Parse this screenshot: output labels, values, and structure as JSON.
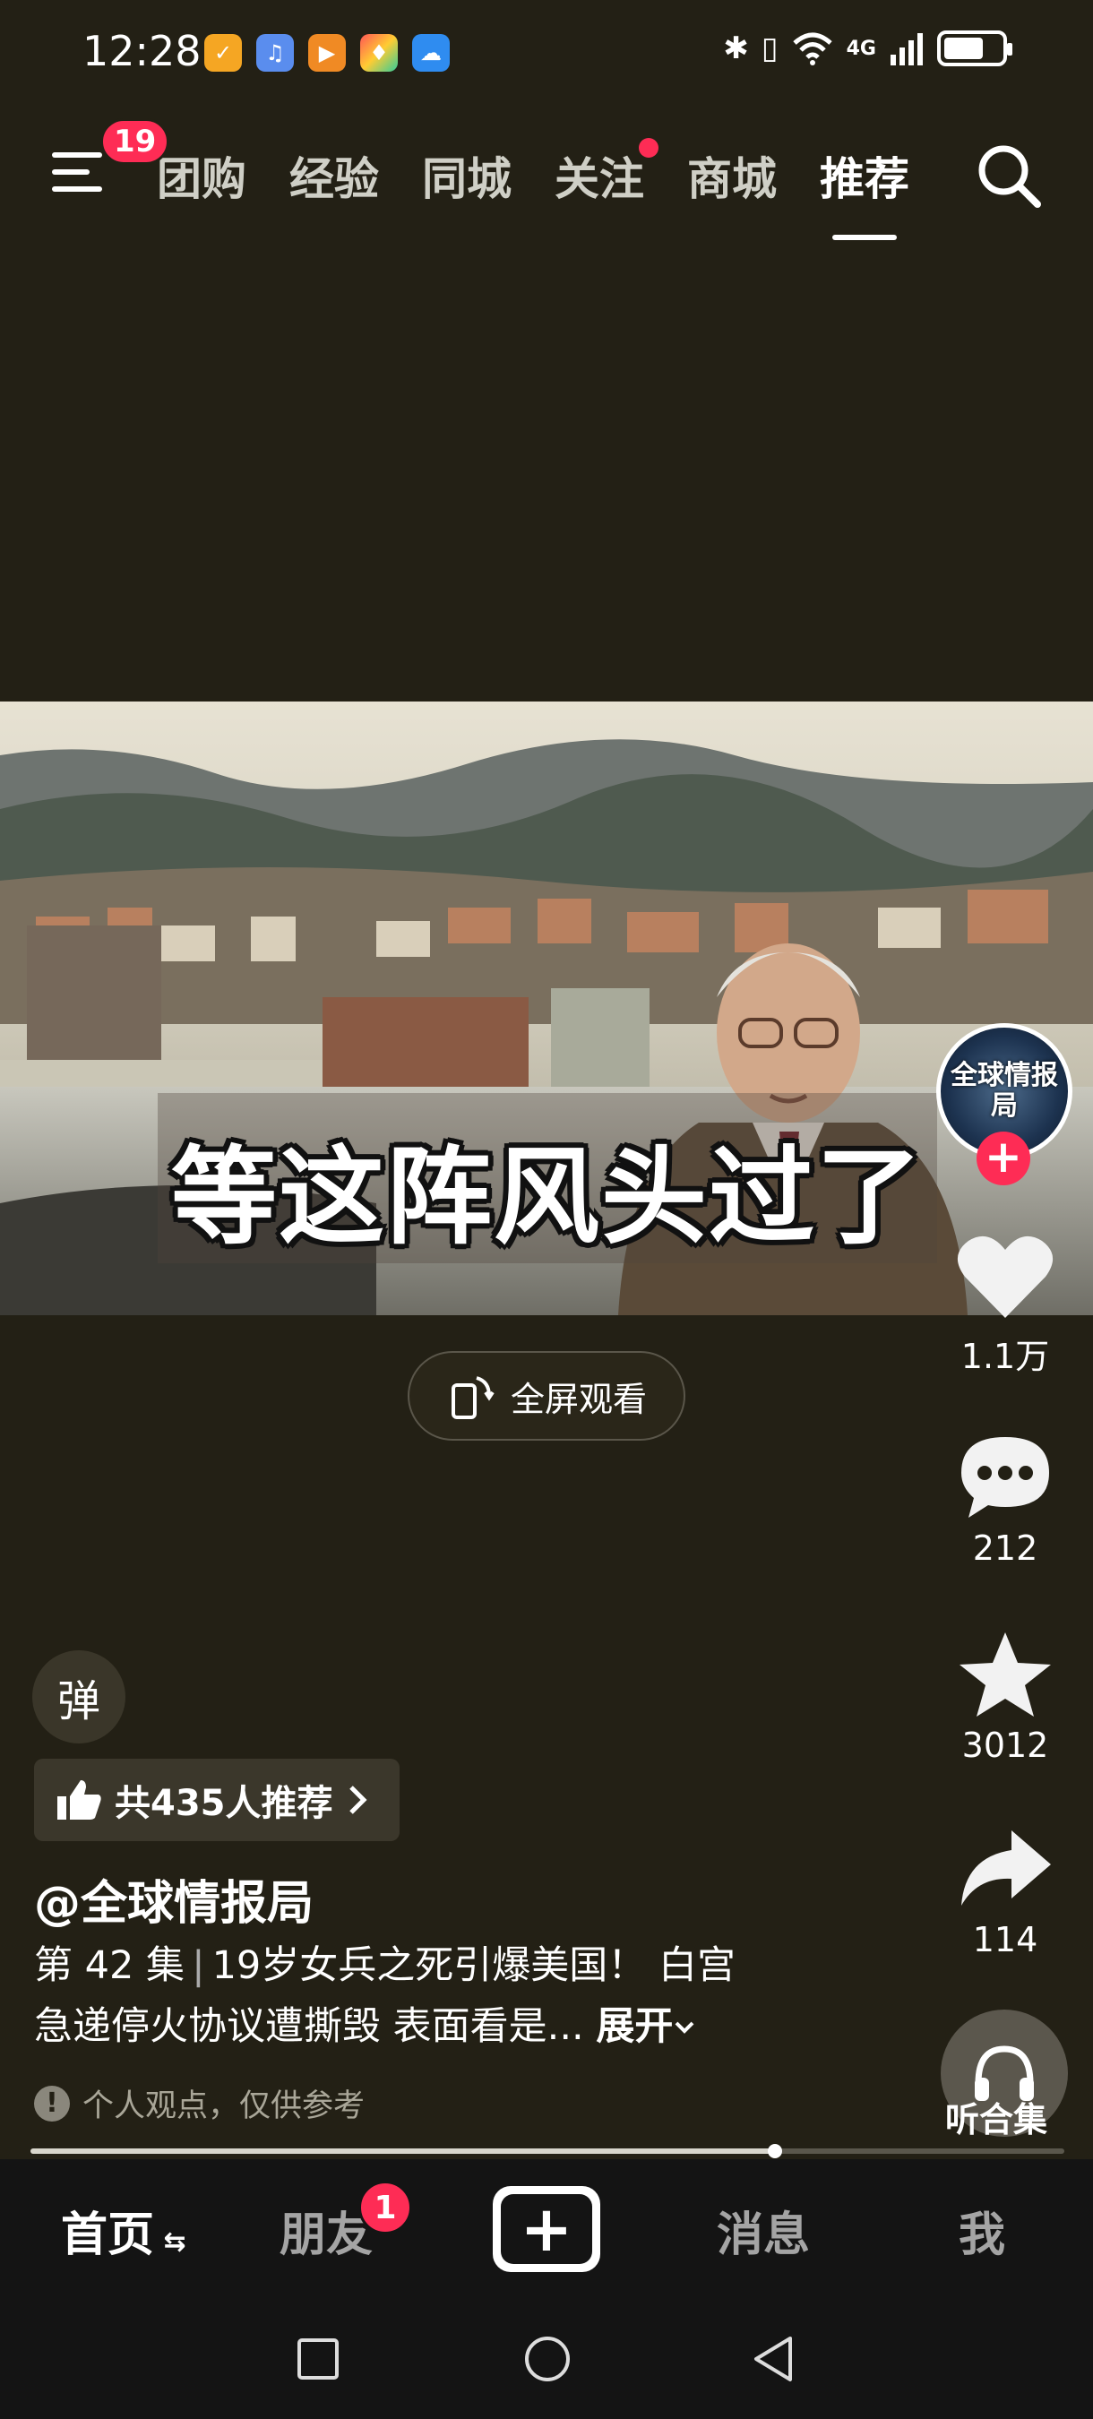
{
  "status_bar": {
    "time": "12:28",
    "network": "4G",
    "battery_level_percent": 70,
    "app_icons": [
      "meituan-icon",
      "music-icon",
      "video-icon",
      "app-icon",
      "weather-icon"
    ]
  },
  "top_nav": {
    "menu_badge": "19",
    "tabs": [
      {
        "label": "团购"
      },
      {
        "label": "经验"
      },
      {
        "label": "同城"
      },
      {
        "label": "关注",
        "dot": true
      },
      {
        "label": "商城"
      },
      {
        "label": "推荐",
        "active": true
      }
    ]
  },
  "video": {
    "subtitle": "等这阵风头过了",
    "fullscreen_label": "全屏观看"
  },
  "rail": {
    "avatar_text": "全球情报局",
    "likes": "1.1万",
    "comments": "212",
    "favorites": "3012",
    "shares": "114",
    "listen_label": "听合集"
  },
  "info": {
    "danmu_label": "弹",
    "recommend_label": "共435人推荐",
    "author": "@全球情报局",
    "episode": "第 42 集",
    "description_line1": "19岁女兵之死引爆美国！ 白宫",
    "description_line2": "急递停火协议遭撕毁 表面看是...",
    "expand_label": "展开",
    "disclaimer": "个人观点，仅供参考"
  },
  "playback": {
    "progress": 0.72
  },
  "bottom_tabs": {
    "home": "首页",
    "friends": "朋友",
    "friends_badge": "1",
    "messages": "消息",
    "me": "我"
  },
  "colors": {
    "background": "#232015",
    "accent": "#fe2c55",
    "bottom_bar": "#141414"
  }
}
